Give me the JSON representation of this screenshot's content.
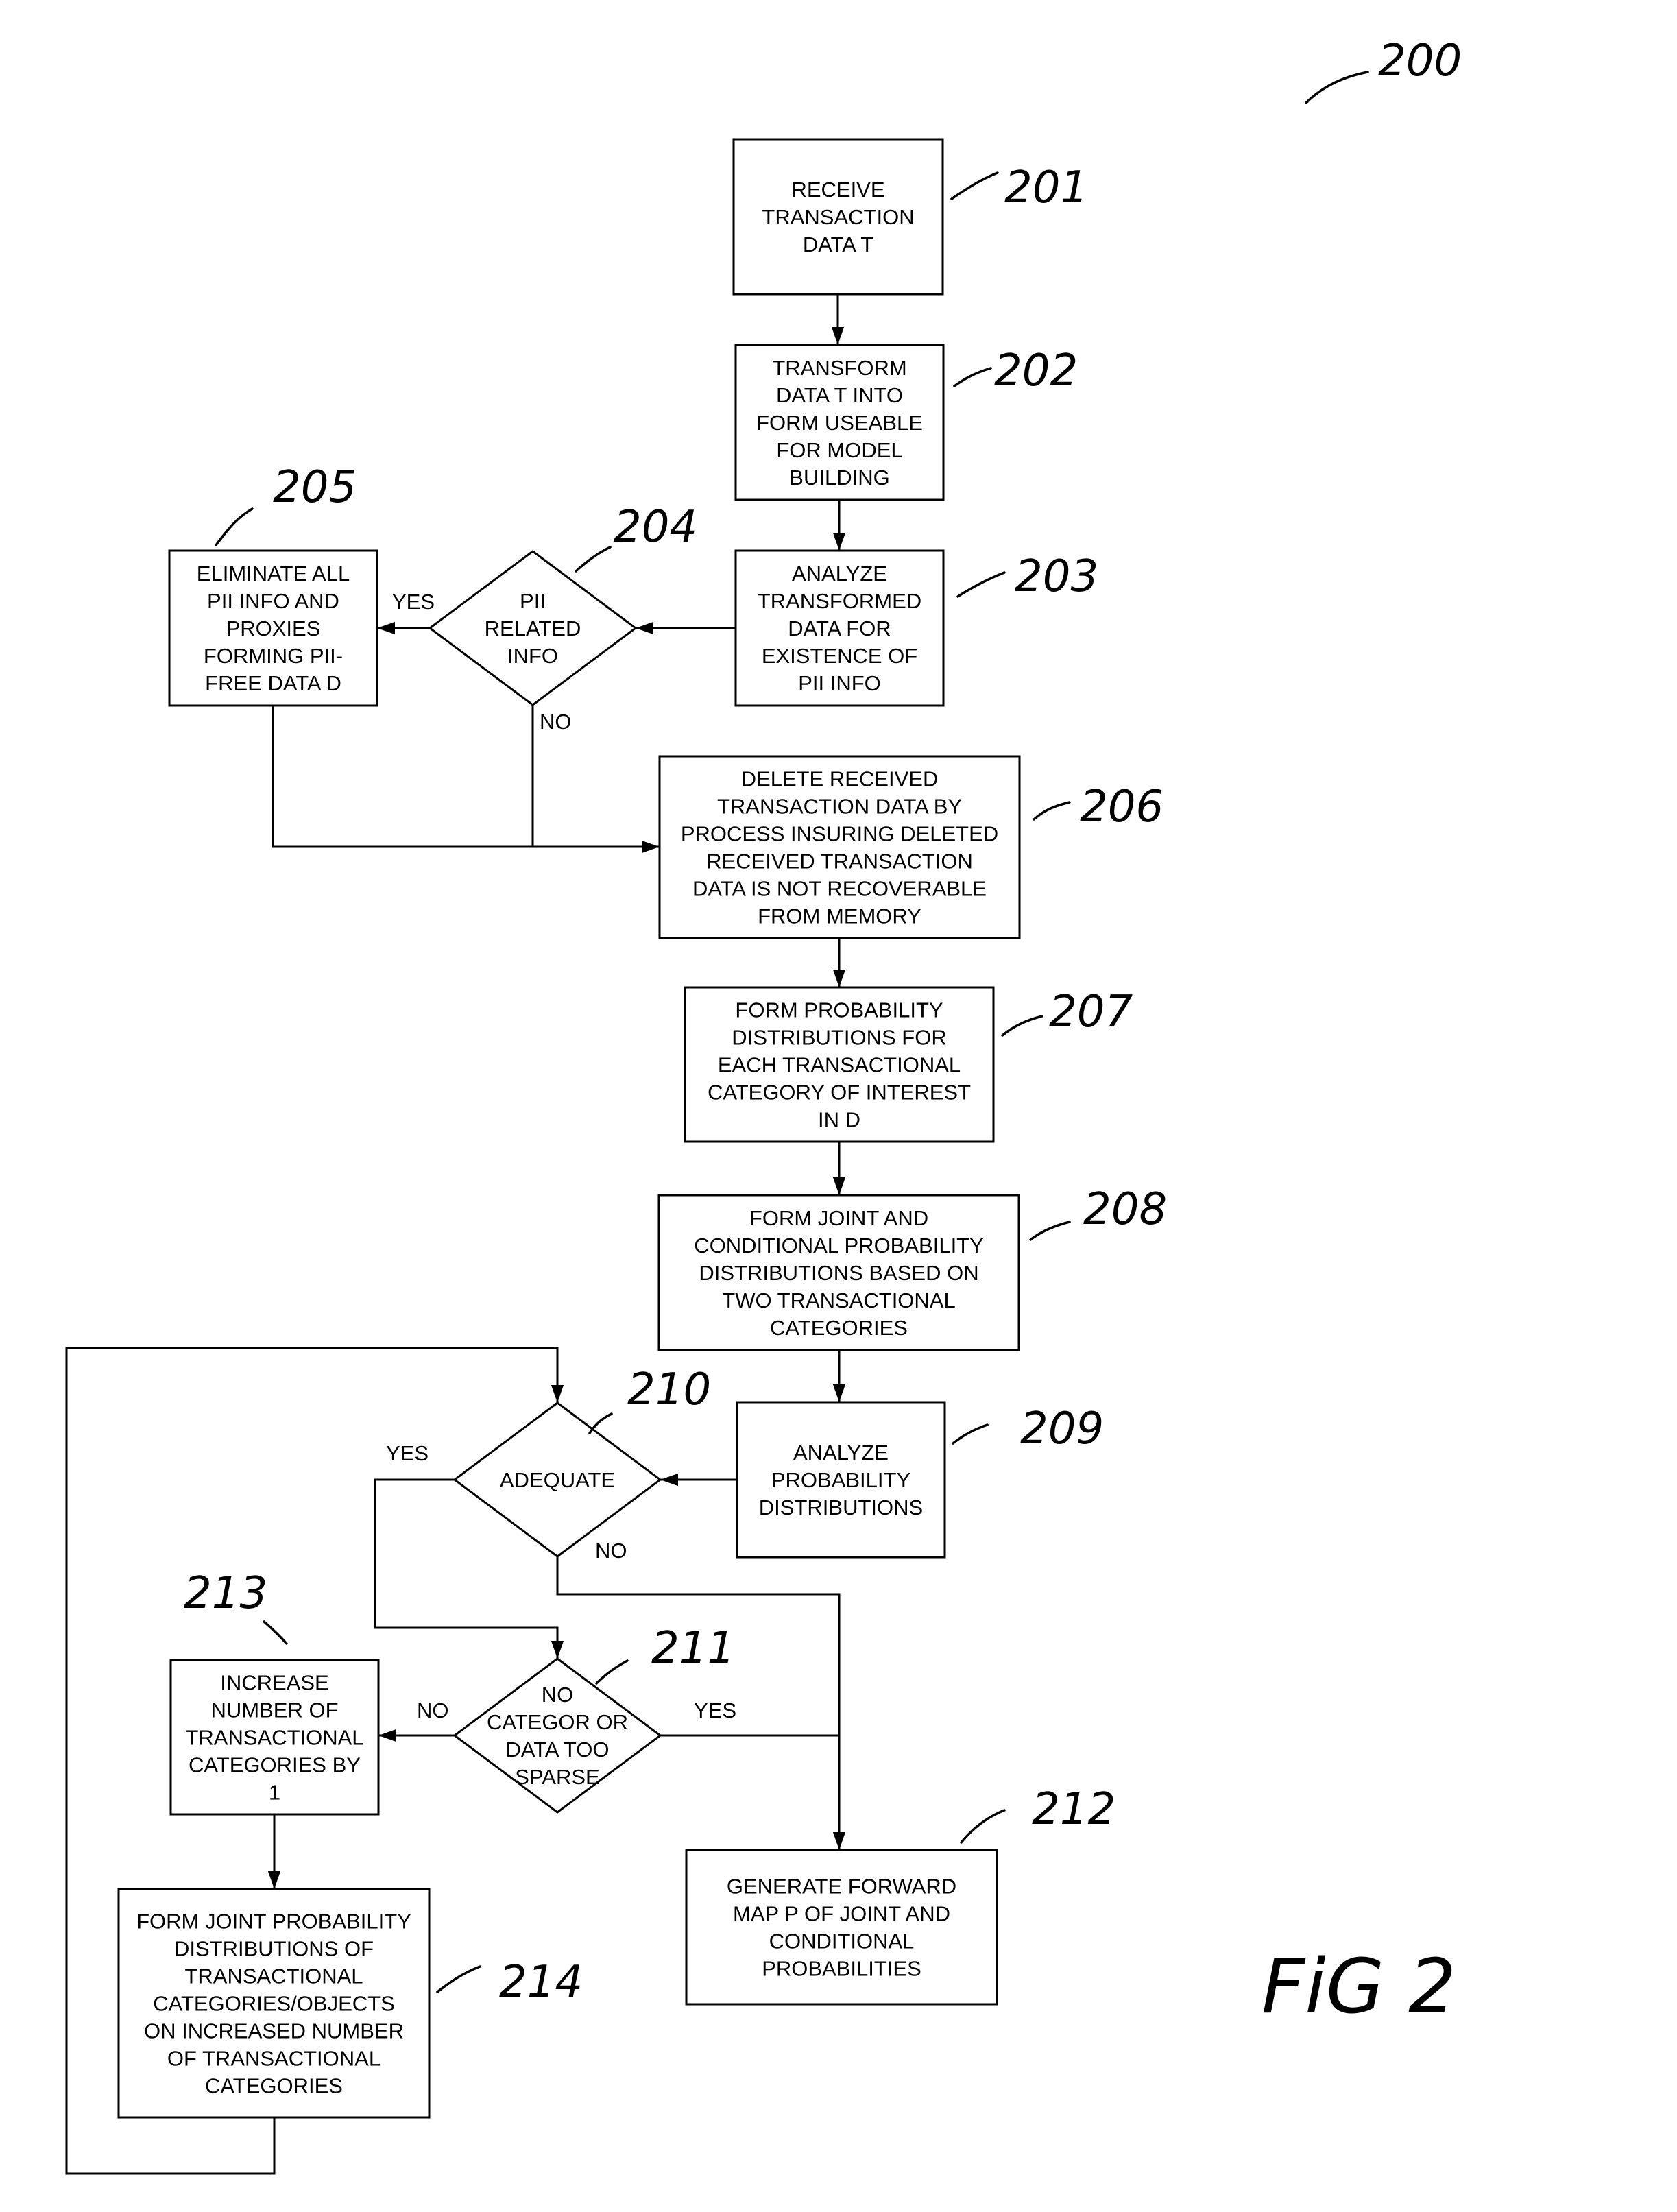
{
  "figure": {
    "label": "FiG 2",
    "ref": "200"
  },
  "nodes": [
    {
      "id": "201",
      "type": "process",
      "ref": "201",
      "lines": [
        "RECEIVE",
        "TRANSACTION",
        "DATA T"
      ]
    },
    {
      "id": "202",
      "type": "process",
      "ref": "202",
      "lines": [
        "TRANSFORM",
        "DATA T INTO",
        "FORM USEABLE",
        "FOR MODEL",
        "BUILDING"
      ]
    },
    {
      "id": "203",
      "type": "process",
      "ref": "203",
      "lines": [
        "ANALYZE",
        "TRANSFORMED",
        "DATA FOR",
        "EXISTENCE OF",
        "PII INFO"
      ]
    },
    {
      "id": "204",
      "type": "decision",
      "ref": "204",
      "lines": [
        "PII",
        "RELATED",
        "INFO"
      ]
    },
    {
      "id": "205",
      "type": "process",
      "ref": "205",
      "lines": [
        "ELIMINATE ALL",
        "PII INFO AND",
        "PROXIES",
        "FORMING  PII-",
        "FREE DATA D"
      ]
    },
    {
      "id": "206",
      "type": "process",
      "ref": "206",
      "lines": [
        "DELETE RECEIVED",
        "TRANSACTION DATA BY",
        "PROCESS INSURING DELETED",
        "RECEIVED TRANSACTION",
        "DATA IS NOT RECOVERABLE",
        "FROM MEMORY"
      ]
    },
    {
      "id": "207",
      "type": "process",
      "ref": "207",
      "lines": [
        "FORM PROBABILITY",
        "DISTRIBUTIONS FOR",
        "EACH TRANSACTIONAL",
        "CATEGORY OF INTEREST",
        "IN D"
      ]
    },
    {
      "id": "208",
      "type": "process",
      "ref": "208",
      "lines": [
        "FORM JOINT AND",
        "CONDITIONAL PROBABILITY",
        "DISTRIBUTIONS BASED ON",
        "TWO TRANSACTIONAL",
        "CATEGORIES"
      ]
    },
    {
      "id": "209",
      "type": "process",
      "ref": "209",
      "lines": [
        "ANALYZE",
        "PROBABILITY",
        "DISTRIBUTIONS"
      ]
    },
    {
      "id": "210",
      "type": "decision",
      "ref": "210",
      "lines": [
        "ADEQUATE"
      ]
    },
    {
      "id": "211",
      "type": "decision",
      "ref": "211",
      "lines": [
        "NO",
        "CATEGOR OR",
        "DATA TOO",
        "SPARSE"
      ]
    },
    {
      "id": "212",
      "type": "process",
      "ref": "212",
      "lines": [
        "GENERATE FORWARD",
        "MAP P OF JOINT AND",
        "CONDITIONAL",
        "PROBABILITIES"
      ]
    },
    {
      "id": "213",
      "type": "process",
      "ref": "213",
      "lines": [
        "INCREASE",
        "NUMBER OF",
        "TRANSACTIONAL",
        "CATEGORIES BY",
        "1"
      ]
    },
    {
      "id": "214",
      "type": "process",
      "ref": "214",
      "lines": [
        "FORM JOINT PROBABILITY",
        "DISTRIBUTIONS OF",
        "TRANSACTIONAL",
        "CATEGORIES/OBJECTS",
        "ON INCREASED NUMBER",
        "OF TRANSACTIONAL",
        "CATEGORIES"
      ]
    }
  ],
  "edges": [
    {
      "from": "201",
      "to": "202",
      "label": ""
    },
    {
      "from": "202",
      "to": "203",
      "label": ""
    },
    {
      "from": "203",
      "to": "204",
      "label": ""
    },
    {
      "from": "204",
      "to": "205",
      "label": "YES"
    },
    {
      "from": "204",
      "to": "206",
      "label": "NO"
    },
    {
      "from": "205",
      "to": "206",
      "label": ""
    },
    {
      "from": "206",
      "to": "207",
      "label": ""
    },
    {
      "from": "207",
      "to": "208",
      "label": ""
    },
    {
      "from": "208",
      "to": "209",
      "label": ""
    },
    {
      "from": "209",
      "to": "210",
      "label": ""
    },
    {
      "from": "210",
      "to": "211",
      "label": "YES"
    },
    {
      "from": "210",
      "to": "212",
      "label": "NO"
    },
    {
      "from": "211",
      "to": "213",
      "label": "NO"
    },
    {
      "from": "211",
      "to": "212",
      "label": "YES"
    },
    {
      "from": "213",
      "to": "214",
      "label": ""
    },
    {
      "from": "214",
      "to": "210",
      "label": ""
    }
  ]
}
